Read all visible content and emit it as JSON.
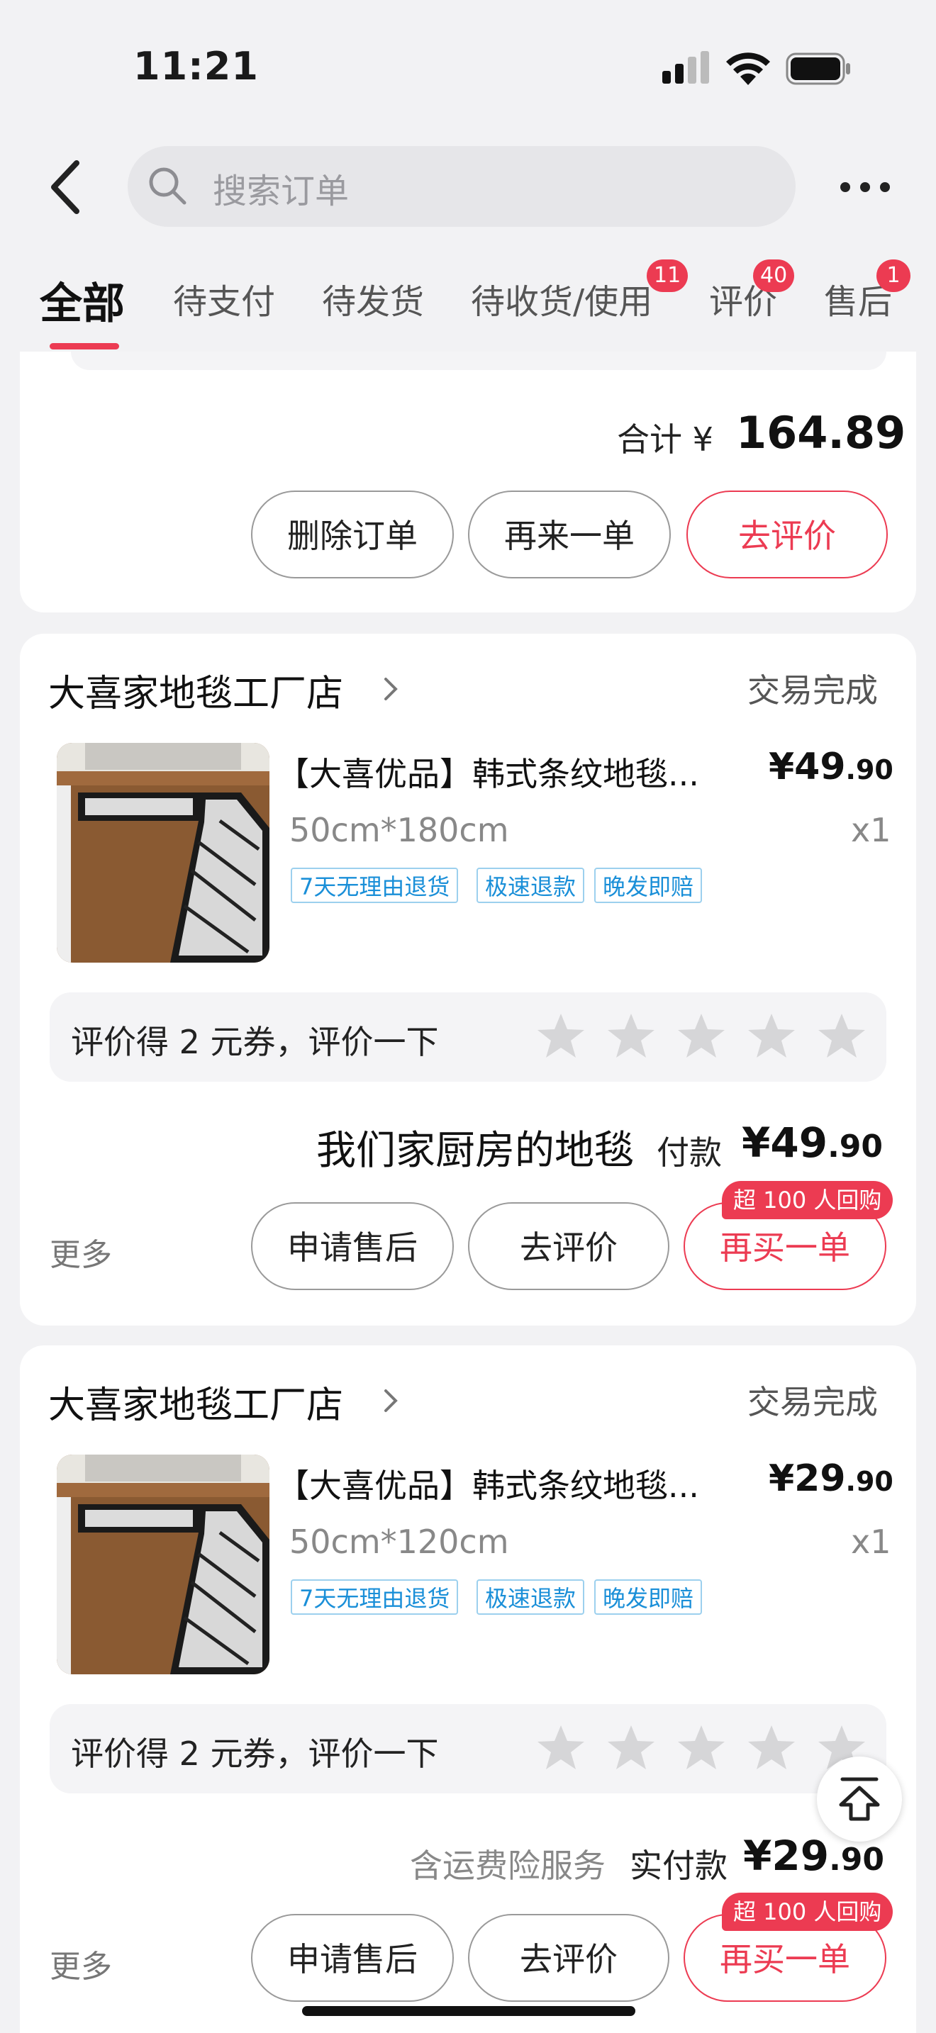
{
  "status_bar": {
    "time": "11:21"
  },
  "search": {
    "placeholder": "搜索订单"
  },
  "tabs": [
    {
      "label": "全部"
    },
    {
      "label": "待支付"
    },
    {
      "label": "待发货"
    },
    {
      "label": "待收货/使用",
      "badge": "11"
    },
    {
      "label": "评价",
      "badge": "40"
    },
    {
      "label": "售后",
      "badge": "1"
    }
  ],
  "order0": {
    "total_label": "合计 ¥",
    "total": "164.89",
    "buttons": [
      "删除订单",
      "再来一单",
      "去评价"
    ]
  },
  "order1": {
    "store": "大喜家地毯工厂店",
    "status": "交易完成",
    "product": {
      "title": "【大喜优品】韩式条纹地毯...",
      "price_main": "¥49",
      "price_dec": ".90",
      "spec": "50cm*180cm",
      "qty": "x1",
      "tags": [
        "7天无理由退货",
        "极速退款",
        "晚发即赔"
      ]
    },
    "review_prompt": "评价得 2 元券，评价一下",
    "overlay_text": "我们家厨房的地毯",
    "paid_label": "付款",
    "paid_main": "¥49",
    "paid_dec": ".90",
    "more": "更多",
    "buttons": [
      "申请售后",
      "去评价",
      "再买一单"
    ],
    "promo": "超 100 人回购"
  },
  "order2": {
    "store": "大喜家地毯工厂店",
    "status": "交易完成",
    "product": {
      "title": "【大喜优品】韩式条纹地毯...",
      "price_main": "¥29",
      "price_dec": ".90",
      "spec": "50cm*120cm",
      "qty": "x1",
      "tags": [
        "7天无理由退货",
        "极速退款",
        "晚发即赔"
      ]
    },
    "review_prompt": "评价得 2 元券，评价一下",
    "insurance": "含运费险服务",
    "paid_label": "实付款",
    "paid_main": "¥29",
    "paid_dec": ".90",
    "more": "更多",
    "buttons": [
      "申请售后",
      "去评价",
      "再买一单"
    ],
    "promo": "超 100 人回购"
  },
  "colors": {
    "accent": "#ec3b52",
    "tag_blue": "#1a8fd8",
    "page_bg": "#f2f2f4"
  }
}
